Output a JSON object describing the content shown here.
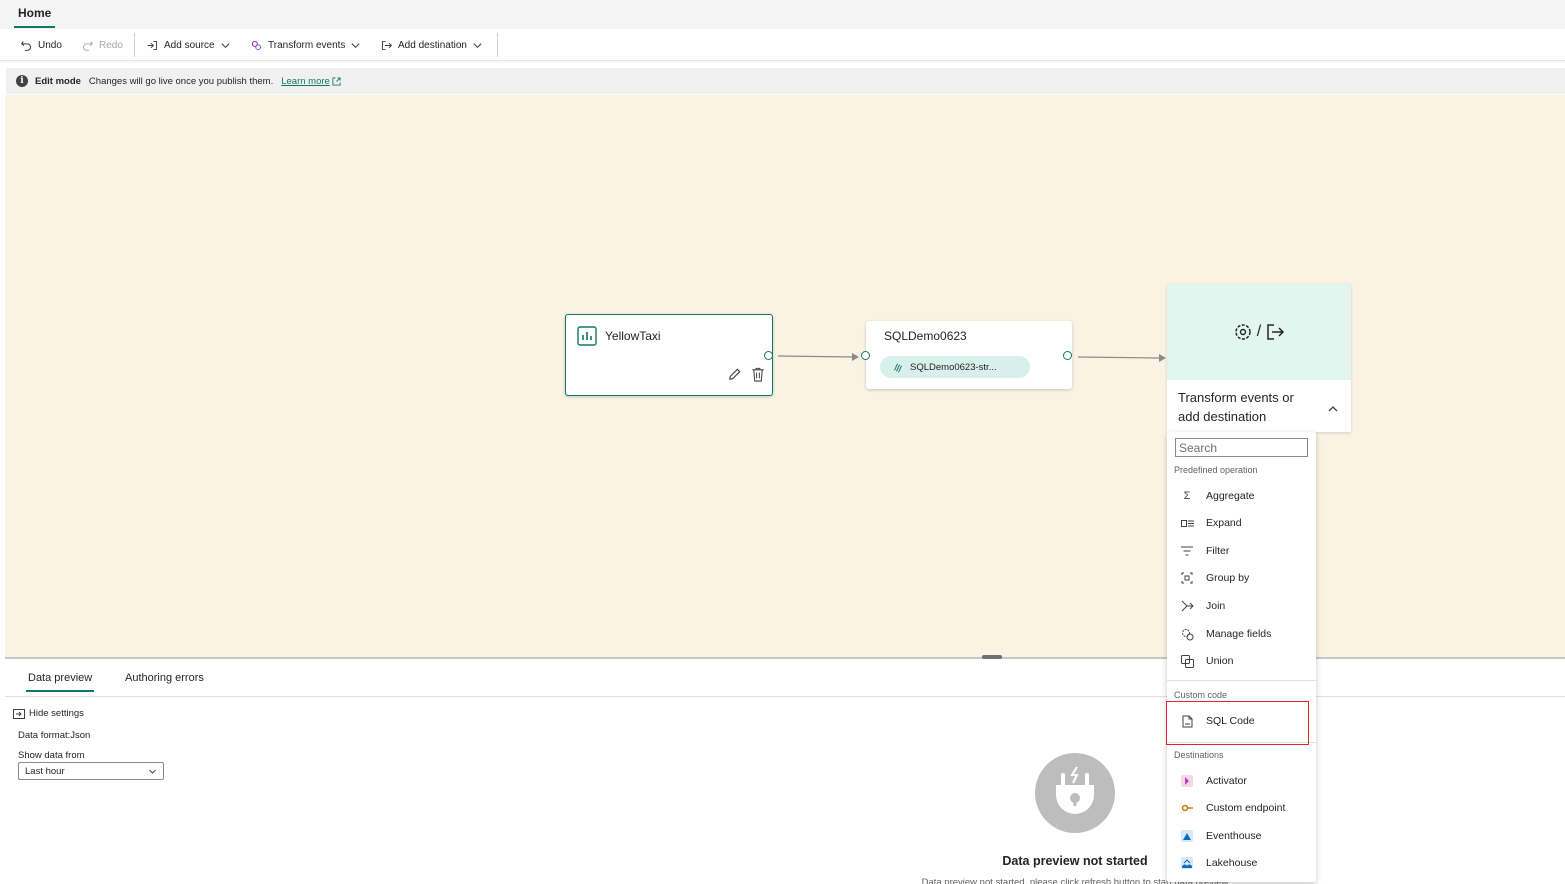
{
  "ribbon": {
    "active_tab": "Home"
  },
  "toolbar": {
    "undo": "Undo",
    "redo": "Redo",
    "add_source": "Add source",
    "transform_events": "Transform events",
    "add_destination": "Add destination"
  },
  "infobar": {
    "mode": "Edit mode",
    "message": "Changes will go live once you publish them.",
    "link": "Learn more"
  },
  "canvas": {
    "source_node": {
      "title": "YellowTaxi"
    },
    "stream_node": {
      "title": "SQLDemo0623",
      "stream_pill": "SQLDemo0623-str..."
    },
    "destination_card": {
      "separator": "/",
      "label": "Transform events or add destination"
    }
  },
  "dropdown": {
    "search_placeholder": "Search",
    "sections": {
      "predefined": "Predefined operation",
      "custom": "Custom code",
      "destinations": "Destinations"
    },
    "predefined_items": [
      "Aggregate",
      "Expand",
      "Filter",
      "Group by",
      "Join",
      "Manage fields",
      "Union"
    ],
    "custom_items": [
      "SQL Code"
    ],
    "destination_items": [
      "Activator",
      "Custom endpoint",
      "Eventhouse",
      "Lakehouse"
    ]
  },
  "bottom_panel": {
    "tabs": [
      "Data preview",
      "Authoring errors"
    ],
    "hide_settings": "Hide settings",
    "data_format": "Data format:Json",
    "show_data_from_label": "Show data from",
    "show_data_from_value": "Last hour",
    "empty_title": "Data preview not started",
    "empty_subtitle": "Data preview not started, please click refresh button to start data preview"
  },
  "colors": {
    "accent": "#117865",
    "canvas_bg": "#faf2e3",
    "highlight": "#e0242b"
  }
}
